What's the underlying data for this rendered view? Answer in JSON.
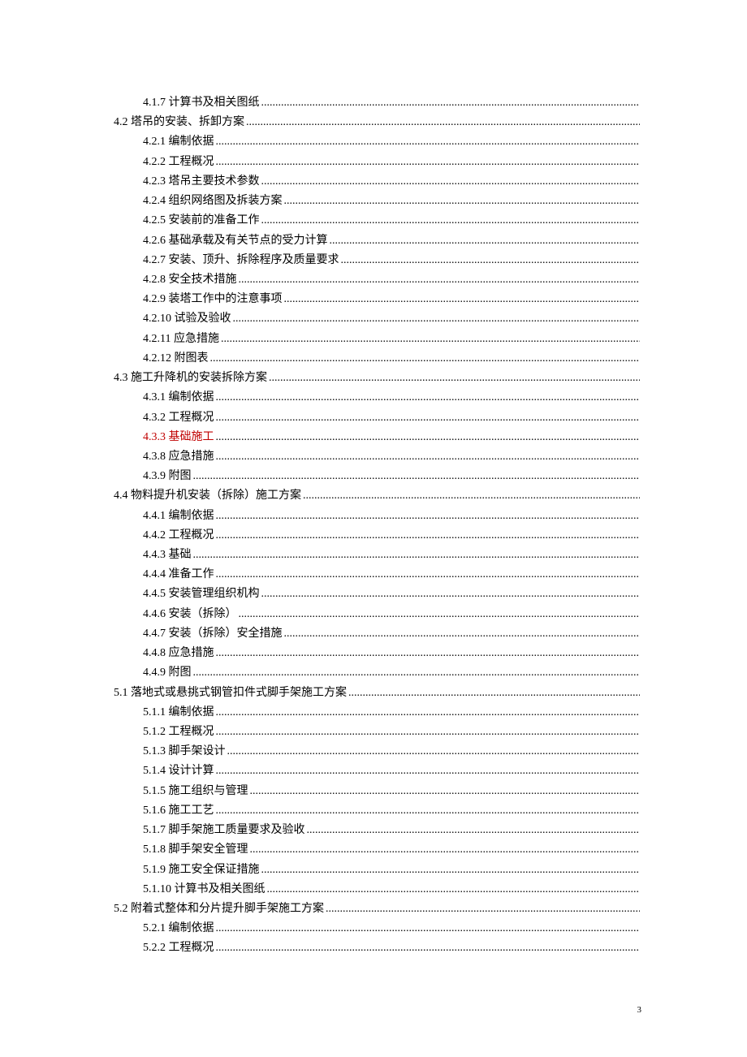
{
  "page_number": "3",
  "toc": [
    {
      "level": 2,
      "num": "4.1.7",
      "title": "计算书及相关图纸",
      "red": false
    },
    {
      "level": 1,
      "num": "4.2",
      "title": "塔吊的安装、拆卸方案",
      "red": false
    },
    {
      "level": 2,
      "num": "4.2.1",
      "title": "编制依据",
      "red": false
    },
    {
      "level": 2,
      "num": "4.2.2",
      "title": "工程概况",
      "red": false
    },
    {
      "level": 2,
      "num": "4.2.3",
      "title": "塔吊主要技术参数",
      "red": false
    },
    {
      "level": 2,
      "num": "4.2.4",
      "title": "组织网络图及拆装方案",
      "red": false
    },
    {
      "level": 2,
      "num": "4.2.5",
      "title": "安装前的准备工作",
      "red": false
    },
    {
      "level": 2,
      "num": "4.2.6",
      "title": "基础承载及有关节点的受力计算",
      "red": false
    },
    {
      "level": 2,
      "num": "4.2.7",
      "title": "安装、顶升、拆除程序及质量要求",
      "red": false
    },
    {
      "level": 2,
      "num": "4.2.8",
      "title": "安全技术措施",
      "red": false
    },
    {
      "level": 2,
      "num": "4.2.9",
      "title": "装塔工作中的注意事项",
      "red": false
    },
    {
      "level": 2,
      "num": "4.2.10",
      "title": "试验及验收",
      "red": false
    },
    {
      "level": 2,
      "num": "4.2.11",
      "title": "应急措施",
      "red": false
    },
    {
      "level": 2,
      "num": "4.2.12",
      "title": " 附图表",
      "red": false
    },
    {
      "level": 1,
      "num": "4.3",
      "title": "施工升降机的安装拆除方案",
      "red": false
    },
    {
      "level": 2,
      "num": "4.3.1",
      "title": "编制依据",
      "red": false
    },
    {
      "level": 2,
      "num": "4.3.2",
      "title": "工程概况",
      "red": false
    },
    {
      "level": 2,
      "num": "4.3.3",
      "title": "基础施工",
      "red": true
    },
    {
      "level": 2,
      "num": "4.3.8",
      "title": "应急措施",
      "red": false
    },
    {
      "level": 2,
      "num": "4.3.9",
      "title": "附图",
      "red": false
    },
    {
      "level": 1,
      "num": "4.4",
      "title": " 物料提升机安装（拆除）施工方案",
      "red": false
    },
    {
      "level": 2,
      "num": "4.4.1",
      "title": "编制依据",
      "red": false
    },
    {
      "level": 2,
      "num": "4.4.2",
      "title": "工程概况",
      "red": false
    },
    {
      "level": 2,
      "num": "4.4.3",
      "title": "基础",
      "red": false
    },
    {
      "level": 2,
      "num": "4.4.4",
      "title": "准备工作",
      "red": false
    },
    {
      "level": 2,
      "num": "4.4.5",
      "title": "安装管理组织机构",
      "red": false
    },
    {
      "level": 2,
      "num": "4.4.6",
      "title": "安装（拆除）",
      "red": false
    },
    {
      "level": 2,
      "num": "4.4.7",
      "title": "安装（拆除）安全措施",
      "red": false
    },
    {
      "level": 2,
      "num": "4.4.8",
      "title": "应急措施",
      "red": false
    },
    {
      "level": 2,
      "num": "4.4.9",
      "title": "附图",
      "red": false
    },
    {
      "level": 1,
      "num": "5.1",
      "title": "落地式或悬挑式钢管扣件式脚手架施工方案",
      "red": false
    },
    {
      "level": 2,
      "num": "5.1.1",
      "title": "编制依据",
      "red": false
    },
    {
      "level": 2,
      "num": "5.1.2",
      "title": "工程概况",
      "red": false
    },
    {
      "level": 2,
      "num": "5.1.3",
      "title": "脚手架设计",
      "red": false
    },
    {
      "level": 2,
      "num": "5.1.4",
      "title": "设计计算",
      "red": false
    },
    {
      "level": 2,
      "num": "5.1.5",
      "title": "施工组织与管理",
      "red": false
    },
    {
      "level": 2,
      "num": "5.1.6",
      "title": "施工工艺",
      "red": false
    },
    {
      "level": 2,
      "num": "5.1.7",
      "title": "脚手架施工质量要求及验收",
      "red": false
    },
    {
      "level": 2,
      "num": "5.1.8",
      "title": "脚手架安全管理",
      "red": false
    },
    {
      "level": 2,
      "num": "5.1.9",
      "title": "施工安全保证措施",
      "red": false
    },
    {
      "level": 2,
      "num": "5.1.10",
      "title": "计算书及相关图纸",
      "red": false
    },
    {
      "level": 1,
      "num": "5.2",
      "title": "附着式整体和分片提升脚手架施工方案",
      "red": false
    },
    {
      "level": 2,
      "num": "5.2.1",
      "title": "编制依据",
      "red": false
    },
    {
      "level": 2,
      "num": "5.2.2",
      "title": "工程概况",
      "red": false
    }
  ]
}
